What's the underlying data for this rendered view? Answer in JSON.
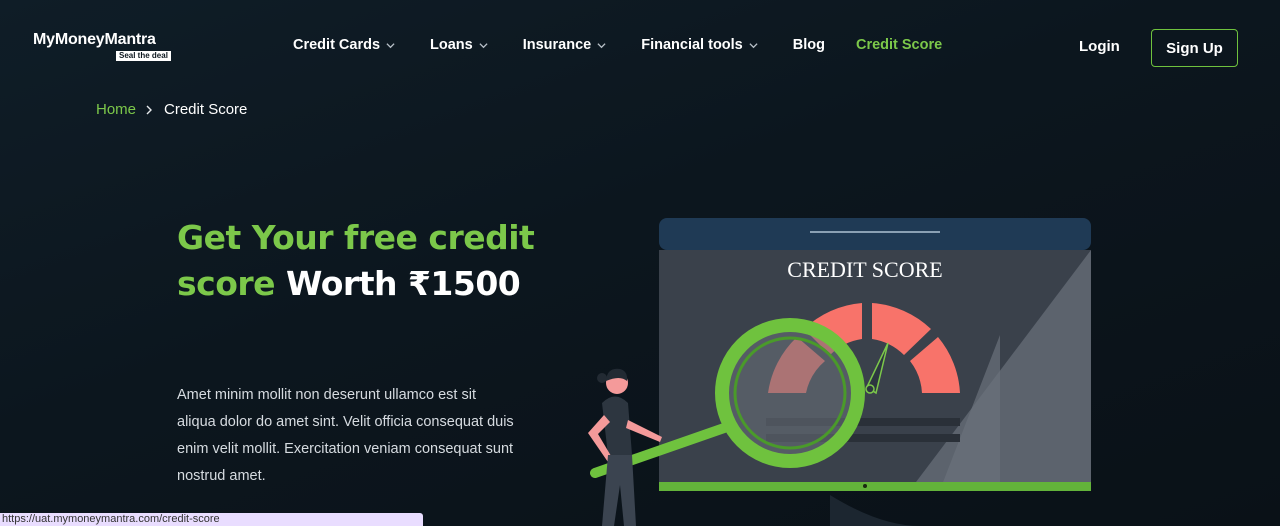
{
  "brand": {
    "name": "MyMoneyMantra",
    "tagline": "Seal the deal"
  },
  "nav": {
    "items": [
      {
        "label": "Credit Cards",
        "has_dropdown": true
      },
      {
        "label": "Loans",
        "has_dropdown": true
      },
      {
        "label": "Insurance",
        "has_dropdown": true
      },
      {
        "label": "Financial tools",
        "has_dropdown": true
      },
      {
        "label": "Blog",
        "has_dropdown": false
      },
      {
        "label": "Credit Score",
        "has_dropdown": false,
        "active": true
      }
    ],
    "login_label": "Login",
    "signup_label": "Sign Up"
  },
  "breadcrumb": {
    "home": "Home",
    "current": "Credit Score"
  },
  "hero": {
    "title_green": "Get Your free credit score",
    "title_white": "Worth ₹1500",
    "description": "Amet minim mollit non deserunt ullamco est sit aliqua dolor do amet sint. Velit officia consequat duis enim velit mollit. Exercitation veniam consequat sunt nostrud amet."
  },
  "illustration": {
    "screen_heading": "CREDIT SCORE"
  },
  "status_bar": {
    "url": "https://uat.mymoneymantra.com/credit-score"
  },
  "colors": {
    "accent_green": "#7cc84a",
    "background": "#0c161e",
    "gauge_red": "#f8736a"
  }
}
